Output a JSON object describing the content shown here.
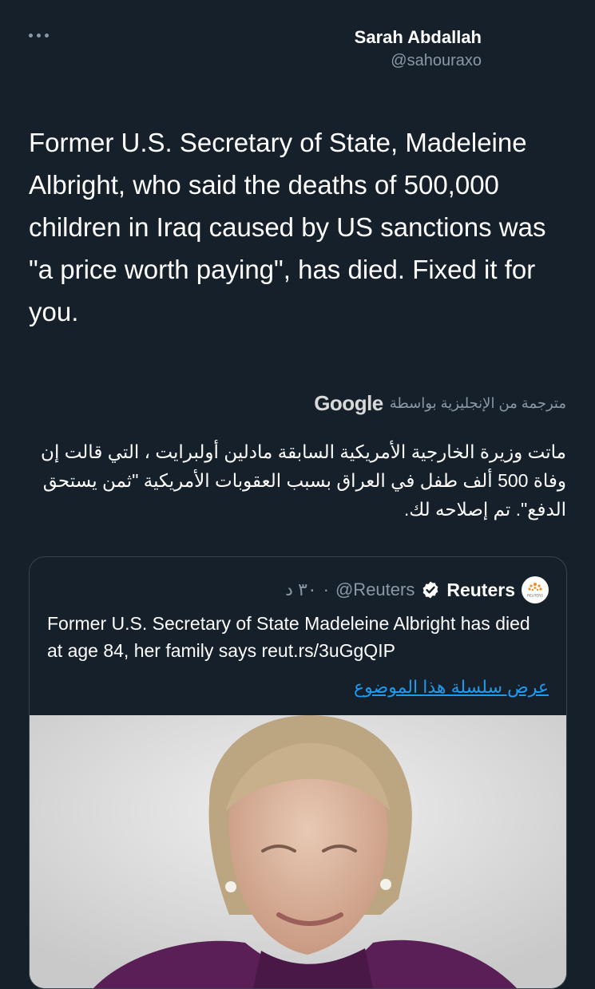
{
  "header": {
    "more_icon": "more-horizontal-icon",
    "author_name": "Sarah Abdallah",
    "author_handle": "@sahouraxo"
  },
  "tweet": {
    "text": "Former U.S. Secretary of State, Madeleine Albright, who said the deaths of 500,000 children in Iraq caused by US sanctions was \"a price worth paying\", has died. Fixed it for you."
  },
  "translation": {
    "label": "مترجمة من الإنجليزية بواسطة",
    "provider": "Google",
    "text": "ماتت وزيرة الخارجية الأمريكية السابقة مادلين أولبرايت ، التي قالت إن وفاة 500 ألف طفل في العراق بسبب العقوبات الأمريكية \"ثمن يستحق الدفع\". تم إصلاحه لك."
  },
  "quoted_tweet": {
    "name": "Reuters",
    "avatar_label": "REUTERS",
    "verified_icon": "verified-badge-icon",
    "handle": "@Reuters",
    "time": "٣٠ د",
    "separator": "·",
    "text": "Former U.S. Secretary of State Madeleine Albright has died at age 84, her family says reut.rs/3uGgQIP",
    "thread_link": "عرض سلسلة هذا الموضوع"
  },
  "colors": {
    "background": "#15202b",
    "secondary_text": "#8b98a5",
    "link": "#1d9bf0",
    "verified": "#ffffff",
    "card_border": "#38444d"
  }
}
